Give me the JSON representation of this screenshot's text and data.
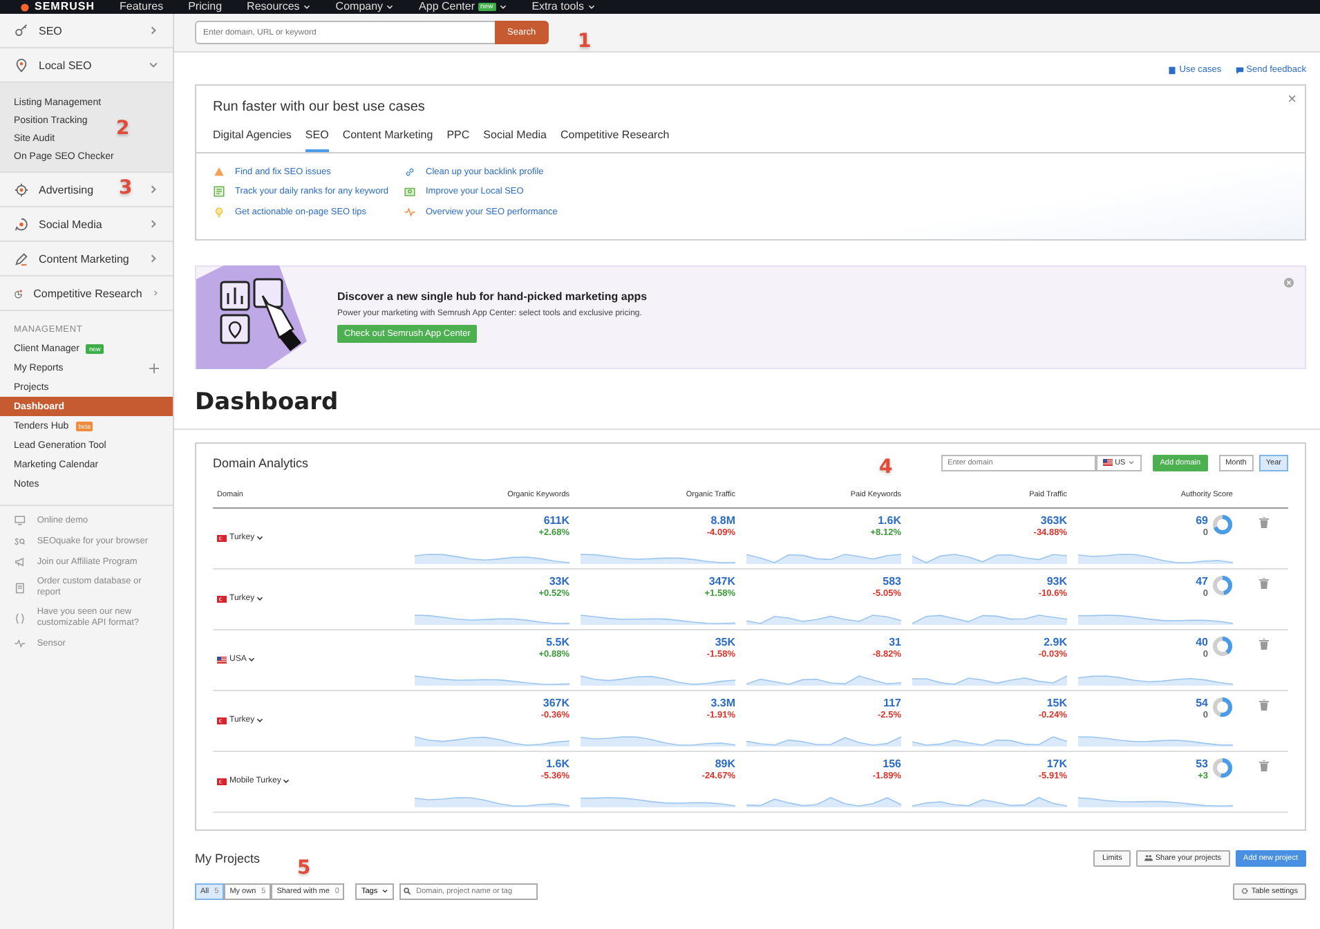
{
  "top_nav": {
    "logo": "SEMRUSH",
    "items": [
      {
        "label": "Features",
        "dropdown": false
      },
      {
        "label": "Pricing",
        "dropdown": false
      },
      {
        "label": "Resources",
        "dropdown": true
      },
      {
        "label": "Company",
        "dropdown": true
      },
      {
        "label": "App Center",
        "badge": "new",
        "dropdown": true
      },
      {
        "label": "Extra tools",
        "dropdown": true
      }
    ]
  },
  "sidebar": {
    "sections": [
      {
        "label": "SEO",
        "expanded": false
      },
      {
        "label": "Local SEO",
        "expanded": true,
        "children": [
          {
            "label": "Listing Management"
          },
          {
            "label": "Position Tracking"
          },
          {
            "label": "Site Audit"
          },
          {
            "label": "On Page SEO Checker"
          }
        ]
      },
      {
        "label": "Advertising",
        "expanded": false
      },
      {
        "label": "Social Media",
        "expanded": false
      },
      {
        "label": "Content Marketing",
        "expanded": false
      },
      {
        "label": "Competitive Research",
        "expanded": false
      }
    ],
    "management_title": "MANAGEMENT",
    "management": [
      {
        "label": "Client Manager",
        "badge": {
          "label": "new",
          "color": "#3fae49"
        },
        "add": false,
        "selected": false
      },
      {
        "label": "My Reports",
        "add": true,
        "selected": false
      },
      {
        "label": "Projects",
        "add": false,
        "selected": false
      },
      {
        "label": "Dashboard",
        "add": false,
        "selected": true
      },
      {
        "label": "Tenders Hub",
        "badge": {
          "label": "beta",
          "color": "#f08a3c"
        },
        "add": false,
        "selected": false
      },
      {
        "label": "Lead Generation Tool",
        "add": false,
        "selected": false
      },
      {
        "label": "Marketing Calendar",
        "add": false,
        "selected": false
      },
      {
        "label": "Notes",
        "add": false,
        "selected": false
      }
    ],
    "footer": [
      {
        "label": "Online demo"
      },
      {
        "label": "SEOquake for your browser"
      },
      {
        "label": "Join our Affiliate Program"
      },
      {
        "label": "Order custom database or report"
      },
      {
        "label": "Have you seen our new customizable API format?"
      },
      {
        "label": "Sensor"
      }
    ]
  },
  "search": {
    "placeholder": "Enter domain, URL or keyword",
    "button": "Search"
  },
  "header_links": [
    {
      "label": "Use cases"
    },
    {
      "label": "Send feedback"
    }
  ],
  "use_cases": {
    "title": "Run faster with our best use cases",
    "close": "×",
    "tabs": [
      {
        "label": "Digital Agencies",
        "selected": false
      },
      {
        "label": "SEO",
        "selected": true
      },
      {
        "label": "Content Marketing",
        "selected": false
      },
      {
        "label": "PPC",
        "selected": false
      },
      {
        "label": "Social Media",
        "selected": false
      },
      {
        "label": "Competitive Research",
        "selected": false
      }
    ],
    "links": [
      {
        "label": "Find and fix SEO issues"
      },
      {
        "label": "Track your daily ranks for any keyword"
      },
      {
        "label": "Get actionable on-page SEO tips"
      },
      {
        "label": "Clean up your backlink profile"
      },
      {
        "label": "Improve your Local SEO"
      },
      {
        "label": "Overview your SEO performance"
      }
    ]
  },
  "banner": {
    "title": "Discover a new single hub for hand-picked marketing apps",
    "text": "Power your marketing with Semrush App Center: select tools and exclusive pricing.",
    "button": "Check out Semrush App Center"
  },
  "page_title": "Dashboard",
  "domain_analytics": {
    "title": "Domain Analytics",
    "domain_placeholder": "Enter domain",
    "database": "US",
    "add_button": "Add domain",
    "periods": [
      {
        "label": "Month",
        "selected": false
      },
      {
        "label": "Year",
        "selected": true
      }
    ],
    "columns": [
      "Domain",
      "Organic Keywords",
      "Organic Traffic",
      "Paid Keywords",
      "Paid Traffic",
      "Authority Score"
    ],
    "rows": [
      {
        "domain": "Turkey",
        "metrics": [
          {
            "value": "611K",
            "change": "+2.68%",
            "color": "#3a9a3a"
          },
          {
            "value": "8.8M",
            "change": "-4.09%",
            "color": "#d9342b"
          },
          {
            "value": "1.6K",
            "change": "+8.12%",
            "color": "#3a9a3a"
          },
          {
            "value": "363K",
            "change": "-34.88%",
            "color": "#d9342b"
          }
        ],
        "authority": {
          "value": "69",
          "change": "0",
          "color": "#666666",
          "level": 0.69
        }
      },
      {
        "domain": "Turkey",
        "metrics": [
          {
            "value": "33K",
            "change": "+0.52%",
            "color": "#3a9a3a"
          },
          {
            "value": "347K",
            "change": "+1.58%",
            "color": "#3a9a3a"
          },
          {
            "value": "583",
            "change": "-5.05%",
            "color": "#d9342b"
          },
          {
            "value": "93K",
            "change": "-10.6%",
            "color": "#d9342b"
          }
        ],
        "authority": {
          "value": "47",
          "change": "0",
          "color": "#666666",
          "level": 0.47
        }
      },
      {
        "domain": "USA",
        "metrics": [
          {
            "value": "5.5K",
            "change": "+0.88%",
            "color": "#3a9a3a"
          },
          {
            "value": "35K",
            "change": "-1.58%",
            "color": "#d9342b"
          },
          {
            "value": "31",
            "change": "-8.82%",
            "color": "#d9342b"
          },
          {
            "value": "2.9K",
            "change": "-0.03%",
            "color": "#d9342b"
          }
        ],
        "authority": {
          "value": "40",
          "change": "0",
          "color": "#666666",
          "level": 0.4
        }
      },
      {
        "domain": "Turkey",
        "metrics": [
          {
            "value": "367K",
            "change": "-0.36%",
            "color": "#d9342b"
          },
          {
            "value": "3.3M",
            "change": "-1.91%",
            "color": "#d9342b"
          },
          {
            "value": "117",
            "change": "-2.5%",
            "color": "#d9342b"
          },
          {
            "value": "15K",
            "change": "-0.24%",
            "color": "#d9342b"
          }
        ],
        "authority": {
          "value": "54",
          "change": "0",
          "color": "#666666",
          "level": 0.54
        }
      },
      {
        "domain": "Mobile Turkey",
        "metrics": [
          {
            "value": "1.6K",
            "change": "-5.36%",
            "color": "#d9342b"
          },
          {
            "value": "89K",
            "change": "-24.67%",
            "color": "#d9342b"
          },
          {
            "value": "156",
            "change": "-1.89%",
            "color": "#d9342b"
          },
          {
            "value": "17K",
            "change": "-5.91%",
            "color": "#d9342b"
          }
        ],
        "authority": {
          "value": "53",
          "change": "+3",
          "color": "#3a9a3a",
          "level": 0.53
        }
      }
    ]
  },
  "projects": {
    "title": "My Projects",
    "buttons": [
      {
        "label": "Limits",
        "kind": "plain"
      },
      {
        "label": "Share your projects",
        "kind": "share"
      },
      {
        "label": "Add new project",
        "kind": "primary"
      }
    ],
    "filters": [
      {
        "label": "All",
        "count": "5",
        "selected": true
      },
      {
        "label": "My own",
        "count": "5",
        "selected": false
      },
      {
        "label": "Shared with me",
        "count": "0",
        "selected": false
      }
    ],
    "tags": "Tags",
    "search_placeholder": "Domain, project name or tag",
    "settings": "Table settings"
  },
  "annotations": [
    "1",
    "2",
    "3",
    "4",
    "5"
  ]
}
